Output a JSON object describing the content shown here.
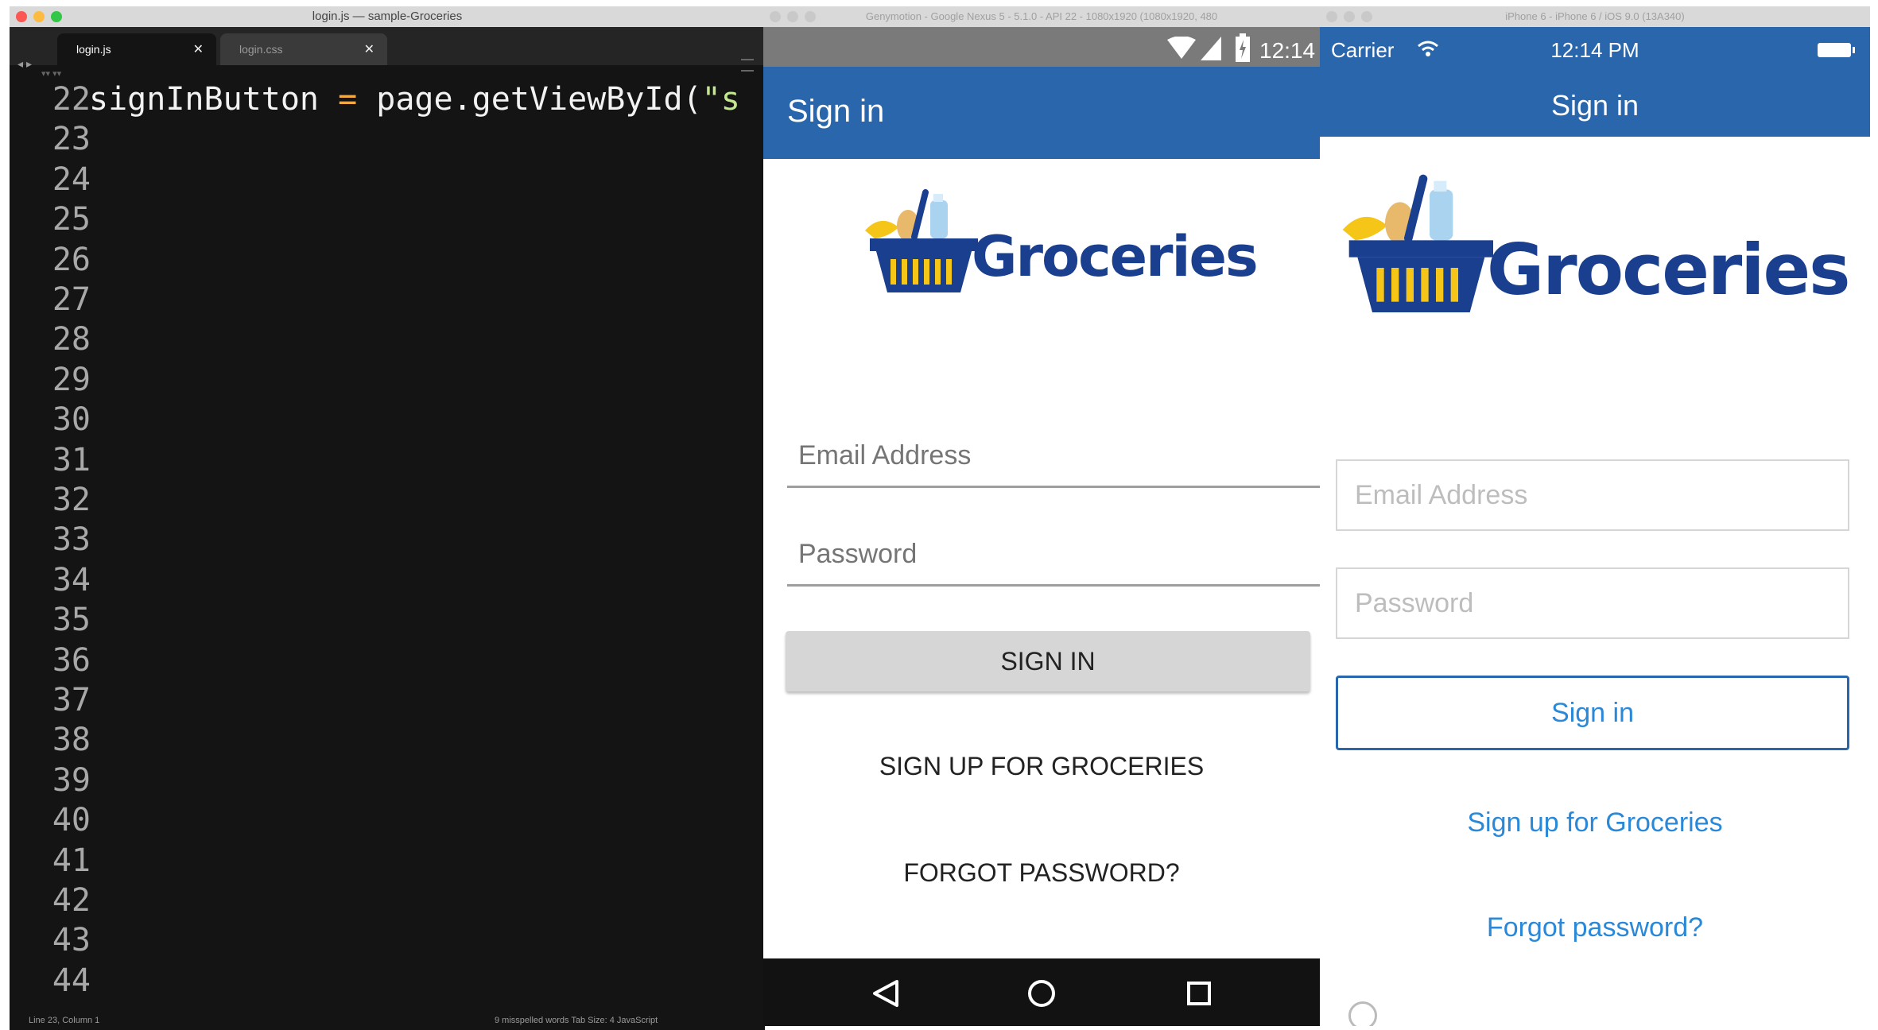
{
  "editor": {
    "window_title": "login.js — sample-Groceries",
    "tabs": [
      {
        "label": "login.js",
        "active": true
      },
      {
        "label": "login.css",
        "active": false
      }
    ],
    "code_lines": [
      {
        "num": "22",
        "text": "signInButton = page.getViewById(\"s"
      },
      {
        "num": "23",
        "text": ""
      },
      {
        "num": "24",
        "text": ""
      },
      {
        "num": "25",
        "text": ""
      },
      {
        "num": "26",
        "text": ""
      },
      {
        "num": "27",
        "text": ""
      },
      {
        "num": "28",
        "text": ""
      },
      {
        "num": "29",
        "text": ""
      },
      {
        "num": "30",
        "text": ""
      },
      {
        "num": "31",
        "text": ""
      },
      {
        "num": "32",
        "text": ""
      },
      {
        "num": "33",
        "text": ""
      },
      {
        "num": "34",
        "text": ""
      },
      {
        "num": "35",
        "text": ""
      },
      {
        "num": "36",
        "text": ""
      },
      {
        "num": "37",
        "text": ""
      },
      {
        "num": "38",
        "text": ""
      },
      {
        "num": "39",
        "text": ""
      },
      {
        "num": "40",
        "text": ""
      },
      {
        "num": "41",
        "text": ""
      },
      {
        "num": "42",
        "text": ""
      },
      {
        "num": "43",
        "text": ""
      },
      {
        "num": "44",
        "text": ""
      }
    ],
    "status_left": "Line 23, Column 1",
    "status_right": "9 misspelled words    Tab Size: 4       JavaScript",
    "colors": {
      "background": "#141414",
      "operator": "#f5a742",
      "text": "#f2f2f2",
      "line_number": "#a8a8a8"
    }
  },
  "android": {
    "window_title": "Genymotion - Google Nexus 5 - 5.1.0 - API 22 - 1080x1920 (1080x1920, 480",
    "status_time": "12:14",
    "action_bar_title": "Sign in",
    "logo_text": "Groceries",
    "email_placeholder": "Email Address",
    "password_placeholder": "Password",
    "sign_in_label": "SIGN IN",
    "sign_up_label": "SIGN UP FOR GROCERIES",
    "forgot_label": "FORGOT PASSWORD?",
    "colors": {
      "primary": "#2a66ab",
      "status_bar": "#7a7a7a",
      "nav_bar": "#121212",
      "button": "#d6d6d6"
    }
  },
  "ios": {
    "window_title": "iPhone 6 - iPhone 6 / iOS 9.0 (13A340)",
    "carrier": "Carrier",
    "time": "12:14 PM",
    "nav_title": "Sign in",
    "logo_text": "Groceries",
    "email_placeholder": "Email Address",
    "password_placeholder": "Password",
    "sign_in_label": "Sign in",
    "sign_up_label": "Sign up for Groceries",
    "forgot_label": "Forgot password?",
    "colors": {
      "primary": "#2a66ab",
      "link": "#2a88d8",
      "field_border": "#d6d6d6"
    }
  },
  "icons": [
    "wifi-icon",
    "cell-signal-icon",
    "battery-icon",
    "back-nav-icon",
    "home-nav-icon",
    "recents-nav-icon",
    "basket-logo-icon",
    "home-button-icon"
  ]
}
